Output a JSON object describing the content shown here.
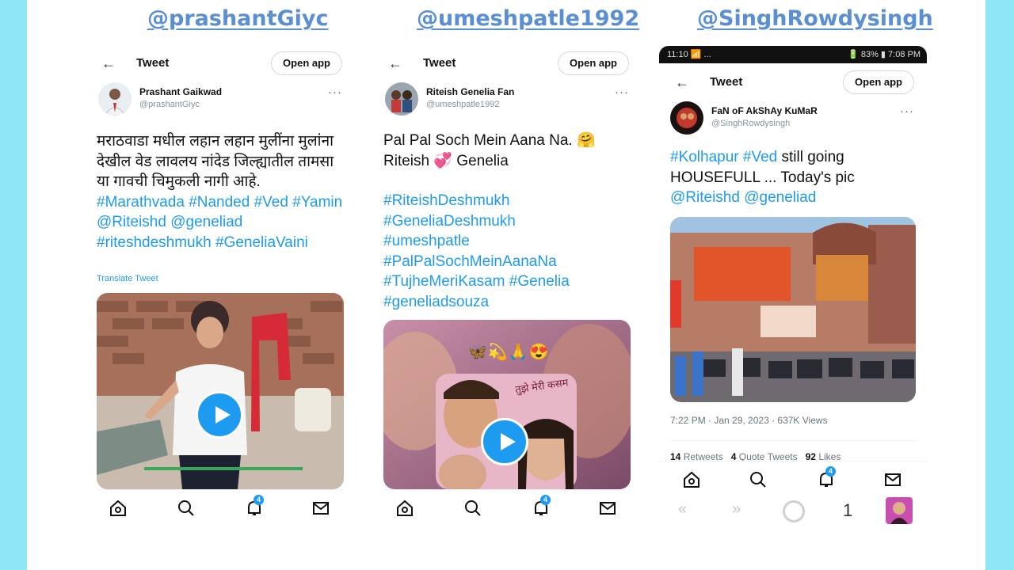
{
  "columns": [
    {
      "handle": "@prashantGiyc",
      "header": {
        "title": "Tweet",
        "open_app": "Open app"
      },
      "author": {
        "name": "Prashant Gaikwad",
        "handle": "@prashantGiyc"
      },
      "text_plain": "मराठवाडा मधील लहान लहान मुलींना मुलांना देखील वेड लावलय नांदेड जिल्ह्यातील तामसा या गावची चिमुकली नागी आहे. ",
      "tags": [
        "#Marathvada",
        "#Nanded",
        "#Ved",
        "#Yamin",
        "@Riteishd",
        "@geneliad",
        "#riteshdeshmukh",
        "#GeneliaVaini"
      ],
      "translate": "Translate Tweet",
      "media": {
        "type": "video",
        "play_icon": "play-icon"
      },
      "nav": {
        "badge": "4"
      }
    },
    {
      "handle": "@umeshpatle1992",
      "header": {
        "title": "Tweet",
        "open_app": "Open app"
      },
      "author": {
        "name": "Riteish Genelia Fan",
        "handle": "@umeshpatle1992"
      },
      "line1": "Pal Pal Soch Mein Aana Na. 🤗",
      "line2a": "Riteish ",
      "line2_emoji": "💞",
      "line2b": " Genelia",
      "tags": [
        "#RiteishDeshmukh",
        "#GeneliaDeshmukh",
        "#umeshpatle",
        "#PalPalSochMeinAanaNa",
        "#TujheMeriKasam",
        "#Genelia",
        "#geneliadsouza"
      ],
      "media": {
        "type": "video",
        "overlay_emojis": "🦋💫🙏😍",
        "poster_text": "तुझे मेरी कसम"
      },
      "nav": {
        "badge": "4"
      }
    },
    {
      "handle": "@SinghRowdysingh",
      "status": {
        "left": "11:10 📶 ...",
        "right": "🔋 83% ▮ 7:08 PM"
      },
      "header": {
        "title": "Tweet",
        "open_app": "Open app"
      },
      "author": {
        "name": "FaN oF AkShAy KuMaR",
        "handle": "@SinghRowdysingh"
      },
      "tags_line1a": "#Kolhapur",
      "tags_line1b": "#Ved",
      "line1_rest": " still going",
      "line2": "HOUSEFULL ... Today's pic",
      "mentions": [
        "@Riteishd",
        "@geneliad"
      ],
      "meta": "7:22 PM · Jan 29, 2023 · 637K Views",
      "stats": {
        "retweets": "14",
        "retweets_label": "Retweets",
        "quotes": "4",
        "quotes_label": "Quote Tweets",
        "likes": "92",
        "likes_label": "Likes"
      },
      "nav": {
        "badge": "4"
      },
      "browser": {
        "tab_count": "1"
      }
    }
  ],
  "colors": {
    "background": "#8fe6f4",
    "twitter_blue": "#1d9bf0",
    "handle_blue": "#5b8fd4"
  }
}
